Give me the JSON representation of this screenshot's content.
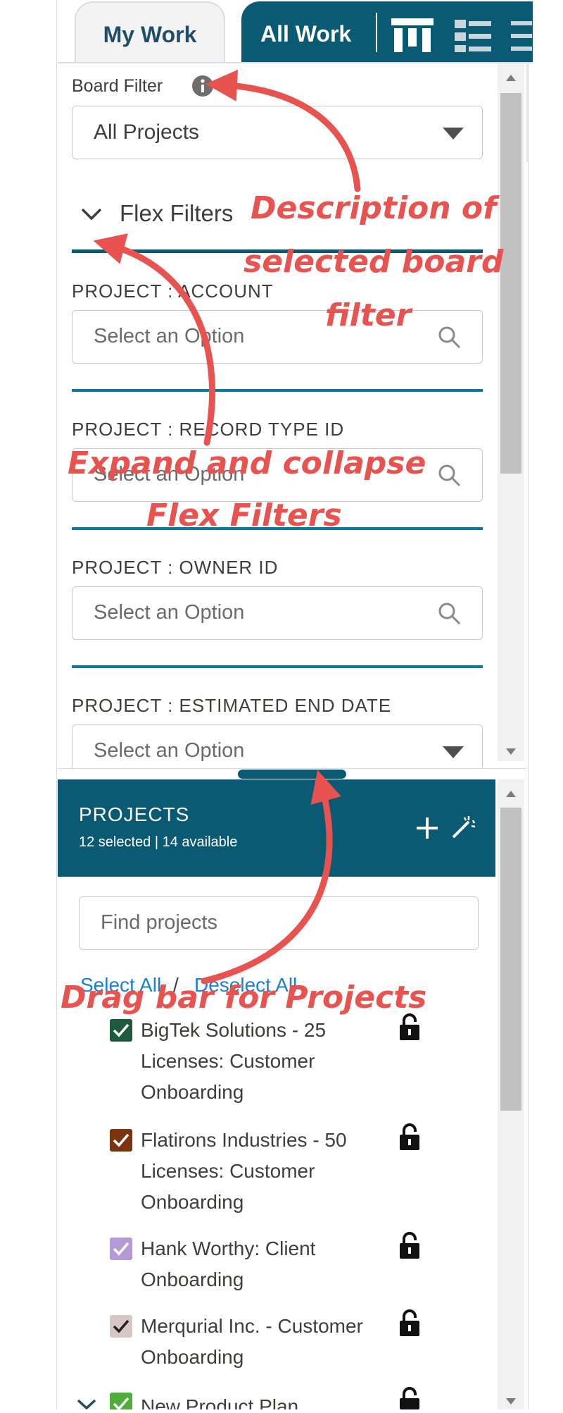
{
  "tabs": {
    "my_work": "My Work",
    "all_work": "All Work"
  },
  "board_filter": {
    "label": "Board Filter",
    "value": "All Projects"
  },
  "flex_filters": {
    "title": "Flex Filters",
    "fields": [
      {
        "label": "PROJECT : ACCOUNT",
        "placeholder": "Select an Option"
      },
      {
        "label": "PROJECT : RECORD TYPE ID",
        "placeholder": "Select an Option"
      },
      {
        "label": "PROJECT : OWNER ID",
        "placeholder": "Select an Option"
      },
      {
        "label": "PROJECT : ESTIMATED END DATE",
        "placeholder": "Select an Option"
      }
    ]
  },
  "projects": {
    "title": "PROJECTS",
    "summary": "12 selected | 14 available",
    "search_placeholder": "Find projects",
    "select_all": "Select All",
    "separator": "/",
    "deselect_all": "Deselect All",
    "items": [
      {
        "lines": [
          "BigTek Solutions - 25",
          "Licenses: Customer",
          "Onboarding"
        ],
        "color": "#1e5a3c"
      },
      {
        "lines": [
          "Flatirons Industries - 50",
          "Licenses: Customer",
          "Onboarding"
        ],
        "color": "#7a3410"
      },
      {
        "lines": [
          "Hank Worthy: Client",
          "Onboarding"
        ],
        "color": "#b59ad8"
      },
      {
        "lines": [
          "Merqurial Inc. - Customer",
          "Onboarding"
        ],
        "color": "#d7c6c6"
      },
      {
        "lines": [
          "New Product Plan"
        ],
        "color": "#4fae3a"
      }
    ]
  },
  "annotations": {
    "board_filter_desc": [
      "Description of",
      "selected board",
      "filter"
    ],
    "expand_collapse": [
      "Expand and collapse",
      "Flex Filters"
    ],
    "drag_bar": "Drag bar for Projects"
  },
  "colors": {
    "accent": "#0b5a73",
    "annotation": "#e8524f",
    "divider": "#0b7a9a"
  }
}
